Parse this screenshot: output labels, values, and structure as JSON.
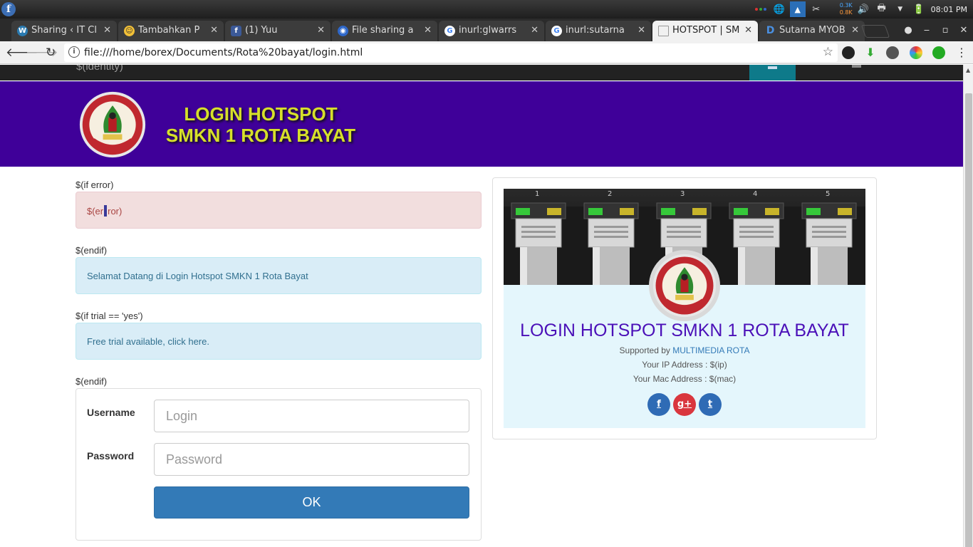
{
  "os": {
    "clock": "08:01 PM",
    "net_up": "0.3K",
    "net_down": "0.8K"
  },
  "tabs": [
    {
      "label": "Sharing ‹ IT Cl",
      "favicon": "wordpress-icon",
      "active": false
    },
    {
      "label": "Tambahkan P",
      "favicon": "emoji-icon",
      "active": false
    },
    {
      "label": "(1) Yuu",
      "favicon": "facebook-icon",
      "active": false
    },
    {
      "label": "File sharing a",
      "favicon": "file-sharing-icon",
      "active": false
    },
    {
      "label": "inurl:glwarrs",
      "favicon": "google-icon",
      "active": false
    },
    {
      "label": "inurl:sutarna",
      "favicon": "google-icon",
      "active": false
    },
    {
      "label": "HOTSPOT | SM",
      "favicon": "page-icon",
      "active": true
    },
    {
      "label": "Sutarna MYOB",
      "favicon": "doc-icon",
      "active": false
    }
  ],
  "toolbar": {
    "url": "file:///home/borex/Documents/Rota%20bayat/login.html"
  },
  "page": {
    "topnav_identity": "$(identity)",
    "header_title_line1": "LOGIN HOTSPOT",
    "header_title_line2": "SMKN 1 ROTA BAYAT",
    "tpl_if_error": "$(if error)",
    "error_pre": "$(er",
    "error_post": "ror)",
    "tpl_endif_1": "$(endif)",
    "welcome": "Selamat Datang di Login Hotspot SMKN 1 Rota Bayat",
    "tpl_if_trial": "$(if trial == 'yes')",
    "trial_text": "Free trial available, ",
    "trial_link": "click here.",
    "tpl_endif_2": "$(endif)",
    "form": {
      "username_label": "Username",
      "username_placeholder": "Login",
      "password_label": "Password",
      "password_placeholder": "Password",
      "submit_label": "OK"
    },
    "card": {
      "ports": [
        "1",
        "2",
        "3",
        "4",
        "5"
      ],
      "title": "LOGIN HOTSPOT SMKN 1 ROTA BAYAT",
      "supported_prefix": "Supported by ",
      "supported_link": "MULTIMEDIA ROTA",
      "ip_line": "Your IP Address : $(ip)",
      "mac_line": "Your Mac Address : $(mac)",
      "social": [
        {
          "name": "facebook",
          "glyph": "f",
          "color": "#2f6bb5"
        },
        {
          "name": "google-plus",
          "glyph": "g+",
          "color": "#d9363e"
        },
        {
          "name": "twitter",
          "glyph": "t",
          "color": "#2f6bb5"
        }
      ]
    }
  },
  "colors": {
    "header_bg": "#3f0099",
    "header_title": "#d6e02a",
    "card_title": "#4b10b8",
    "primary_button": "#337ab7"
  }
}
